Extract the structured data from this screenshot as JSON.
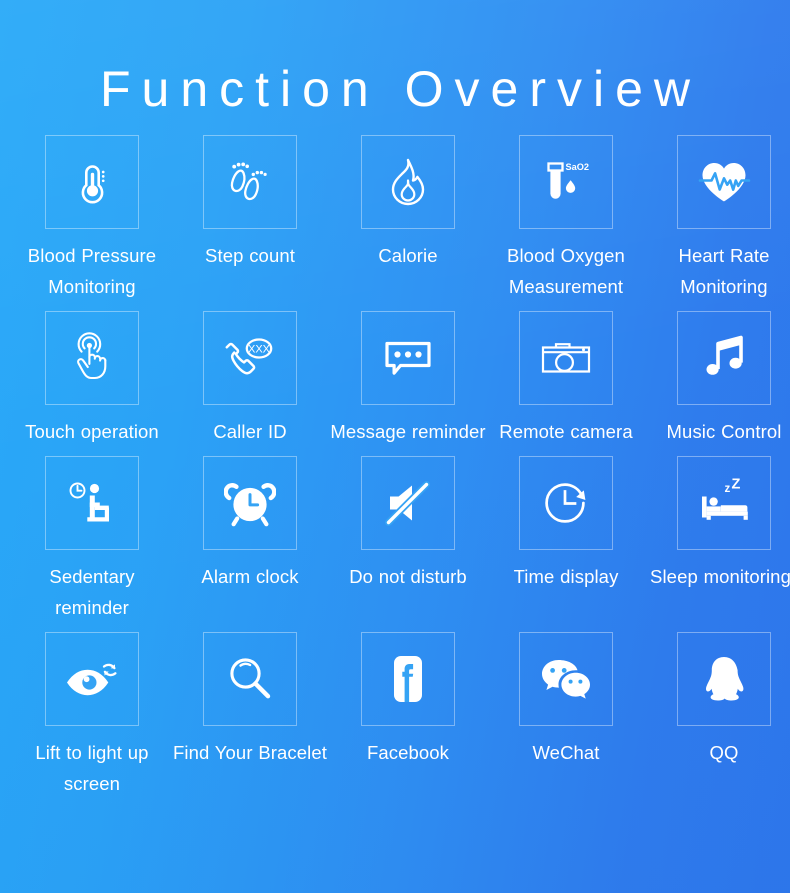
{
  "header": {
    "title": "Function Overview"
  },
  "theme": {
    "background_start": "#28a9f8",
    "background_end": "#2e77ec",
    "text_color": "#ffffff",
    "box_border_color": "rgba(255,255,255,0.38)"
  },
  "grid": {
    "columns": 5,
    "rows": 4,
    "items": [
      {
        "icon": "thermometer-icon",
        "label": "Blood Pressure Monitoring"
      },
      {
        "icon": "footprints-icon",
        "label": "Step count"
      },
      {
        "icon": "flame-icon",
        "label": "Calorie"
      },
      {
        "icon": "test-tube-sao2-icon",
        "label": "Blood Oxygen Measurement",
        "icon_text": "SaO2"
      },
      {
        "icon": "heart-pulse-icon",
        "label": "Heart Rate Monitoring"
      },
      {
        "icon": "hand-tap-icon",
        "label": "Touch operation"
      },
      {
        "icon": "phone-caller-id-icon",
        "label": "Caller ID",
        "icon_text": "XXX"
      },
      {
        "icon": "speech-bubble-icon",
        "label": "Message reminder"
      },
      {
        "icon": "camera-icon",
        "label": "Remote camera"
      },
      {
        "icon": "music-note-icon",
        "label": "Music Control"
      },
      {
        "icon": "sitting-person-clock-icon",
        "label": "Sedentary reminder"
      },
      {
        "icon": "alarm-clock-icon",
        "label": "Alarm clock"
      },
      {
        "icon": "mute-speaker-icon",
        "label": "Do not disturb"
      },
      {
        "icon": "clock-arrow-icon",
        "label": "Time display"
      },
      {
        "icon": "bed-sleep-icon",
        "label": "Sleep monitoring",
        "icon_text": "zZ"
      },
      {
        "icon": "eye-refresh-icon",
        "label": "Lift to light up screen"
      },
      {
        "icon": "magnifier-icon",
        "label": "Find Your Bracelet"
      },
      {
        "icon": "facebook-icon",
        "label": "Facebook"
      },
      {
        "icon": "wechat-icon",
        "label": "WeChat"
      },
      {
        "icon": "qq-penguin-icon",
        "label": "QQ"
      }
    ]
  }
}
